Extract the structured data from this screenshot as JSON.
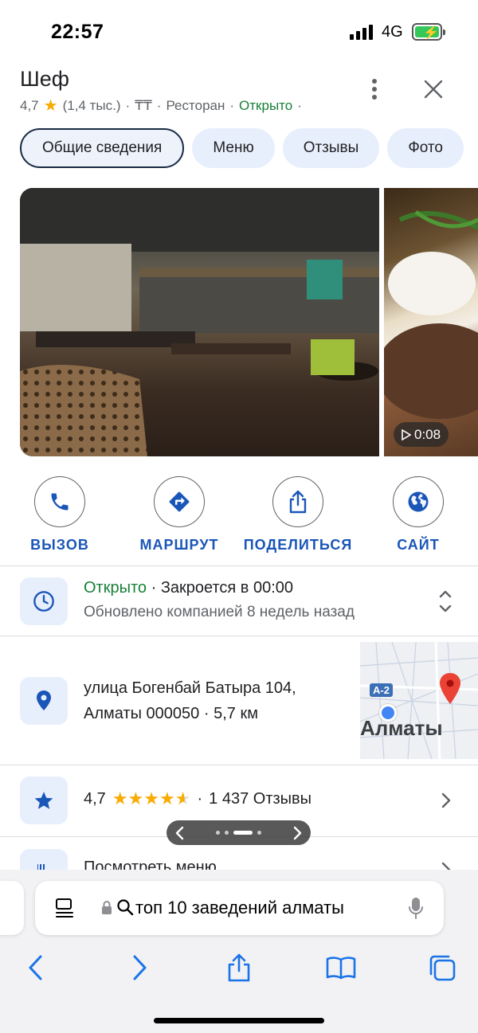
{
  "status_bar": {
    "time": "22:57",
    "network": "4G"
  },
  "place": {
    "name": "Шеф",
    "rating": "4,7",
    "reviews_short": "(1,4 тыс.)",
    "price": "₸₸",
    "category": "Ресторан",
    "status": "Открыто",
    "separator": "·"
  },
  "tabs": [
    {
      "label": "Общие сведения",
      "active": true
    },
    {
      "label": "Меню"
    },
    {
      "label": "Отзывы"
    },
    {
      "label": "Фото"
    }
  ],
  "photos": {
    "video_duration": "0:08"
  },
  "actions": [
    {
      "label": "ВЫЗОВ",
      "icon": "phone-icon"
    },
    {
      "label": "МАРШРУТ",
      "icon": "directions-icon"
    },
    {
      "label": "ПОДЕЛИТЬСЯ",
      "icon": "share-icon"
    },
    {
      "label": "САЙТ",
      "icon": "globe-icon"
    }
  ],
  "hours": {
    "status": "Открыто",
    "closes": "Закроется в 00:00",
    "updated": "Обновлено компанией 8 недель назад"
  },
  "address": {
    "line1": "улица Богенбай Батыра 104,",
    "line2": "Алматы 000050",
    "distance": "5,7 км",
    "map_city": "Алматы",
    "map_road": "A-2"
  },
  "rating_row": {
    "value": "4,7",
    "reviews": "1 437 Отзывы"
  },
  "menu_row": {
    "label": "Посмотреть меню"
  },
  "safari": {
    "query": "топ 10 заведений алматы"
  },
  "colors": {
    "accent": "#1a56b8",
    "open": "#188038",
    "star": "#f9ab00",
    "chip": "#e8effc"
  }
}
